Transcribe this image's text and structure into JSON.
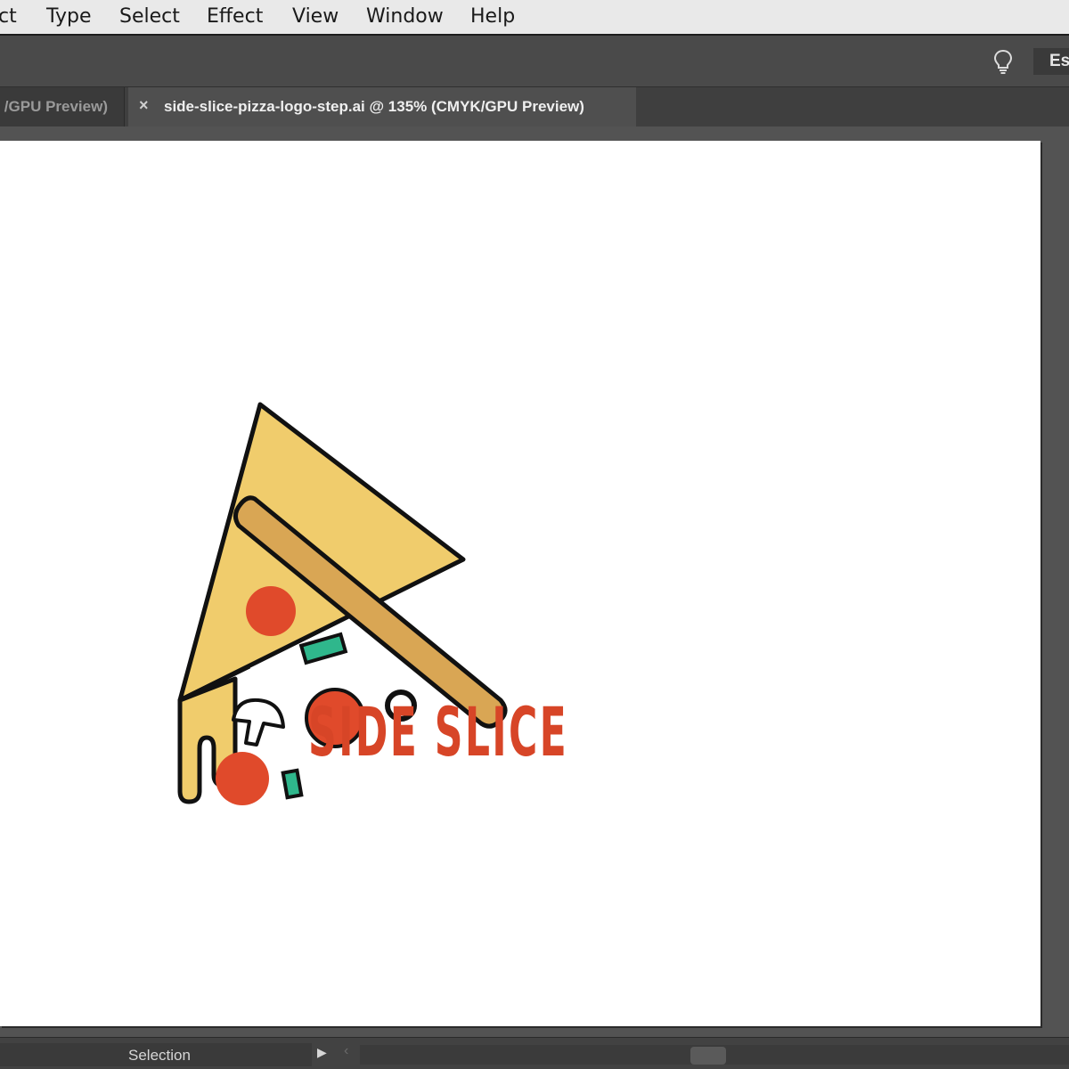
{
  "menu": {
    "items": [
      "ct",
      "Type",
      "Select",
      "Effect",
      "View",
      "Window",
      "Help"
    ]
  },
  "control_bar": {
    "workspace_label": "Es",
    "icons": [
      "lightbulb-icon"
    ]
  },
  "tabs": {
    "inactive_label": "/GPU Preview)",
    "active_close": "×",
    "active_label": "side-slice-pizza-logo-step.ai @ 135% (CMYK/GPU Preview)"
  },
  "artboard": {
    "logo_text": "SIDE SLICE"
  },
  "status": {
    "tool": "Selection",
    "arrow": "▶",
    "scroll_left": "‹"
  },
  "colors": {
    "logo_text": "#d74527",
    "crust": "#d9a654",
    "cheese": "#f0cc6c",
    "pepperoni": "#e04a2b",
    "pepper": "#2fb78c",
    "outline": "#111111"
  }
}
